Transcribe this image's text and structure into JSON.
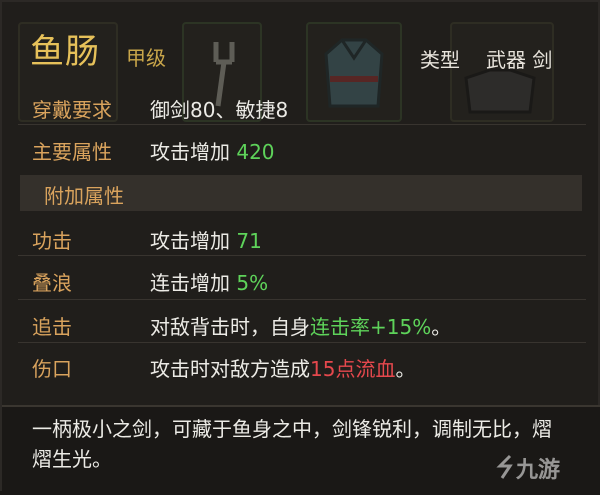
{
  "item": {
    "name": "鱼肠",
    "grade": "甲级",
    "type_label": "类型",
    "type_value": "武器 剑"
  },
  "requirement": {
    "label": "穿戴要求",
    "value": "御剑80、敏捷8"
  },
  "main_attr": {
    "label": "主要属性",
    "text": "攻击增加 ",
    "number": "420"
  },
  "extra_section": {
    "title": "附加属性"
  },
  "extra_attrs": [
    {
      "label": "功击",
      "text": "攻击增加 ",
      "number": "71"
    },
    {
      "label": "叠浪",
      "text": "连击增加 ",
      "number": "5%"
    },
    {
      "label": "追击",
      "pre": "对敌背击时，自身",
      "highlight": "连击率+15%",
      "post": "。"
    },
    {
      "label": "伤口",
      "pre": "攻击时对敌方造成",
      "highlight": "15点流血",
      "post": "。"
    }
  ],
  "description": "一柄极小之剑，可藏于鱼身之中，剑锋锐利，调制无比，熠熠生光。",
  "watermark": "九游",
  "colors": {
    "title_gold": "#e6c15a",
    "label_orange": "#d9a35d",
    "value_green": "#5ed35a",
    "value_red": "#e5484d"
  }
}
